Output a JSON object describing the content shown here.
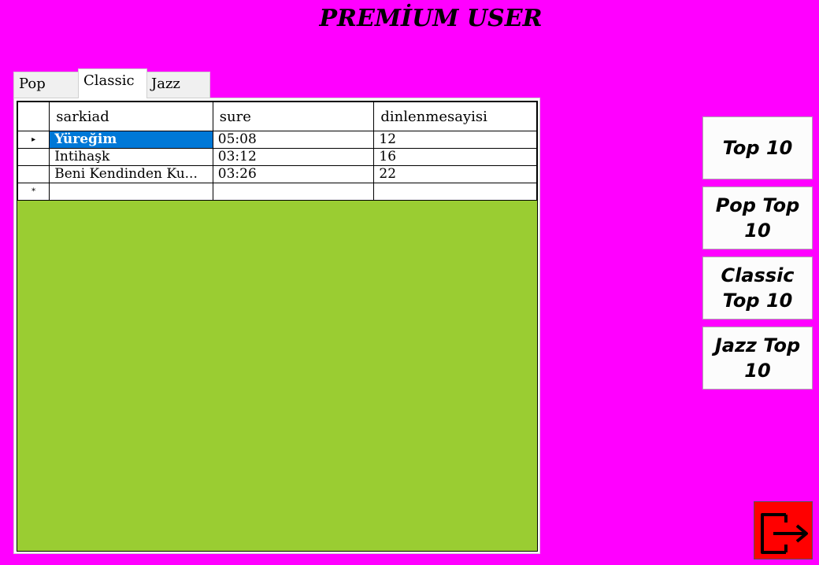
{
  "header": {
    "title": "PREMİUM USER"
  },
  "tabs": [
    {
      "label": "Pop"
    },
    {
      "label": "Classic"
    },
    {
      "label": "Jazz"
    }
  ],
  "grid": {
    "columns": [
      "sarkiad",
      "sure",
      "dinlenmesayisi"
    ],
    "rows": [
      {
        "marker": "▸",
        "cells": [
          "Yüreğim",
          "05:08",
          "12"
        ]
      },
      {
        "marker": "",
        "cells": [
          "Intihaşk",
          "03:12",
          "16"
        ]
      },
      {
        "marker": "",
        "cells": [
          "Beni Kendinden Ku...",
          "03:26",
          "22"
        ]
      }
    ],
    "new_row_marker": "*"
  },
  "buttons": {
    "top10": "Top 10",
    "pop_top10": "Pop Top 10",
    "classic_top10": "Classic Top 10",
    "jazz_top10": "Jazz Top 10"
  },
  "exit_icon": "exit-icon",
  "colors": {
    "background": "#FF00FF",
    "grid_background": "#9ACD32",
    "selection": "#0078D7",
    "exit": "#FF0000"
  }
}
